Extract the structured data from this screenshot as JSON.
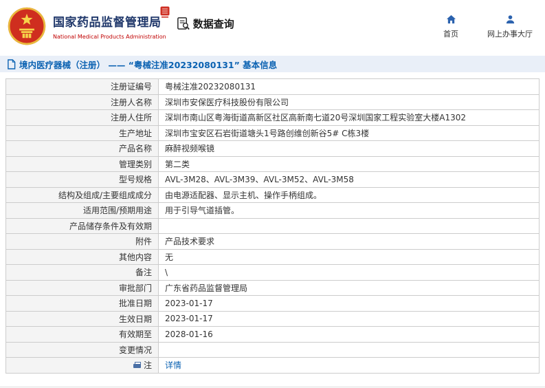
{
  "header": {
    "org_name": "国家药品监督管理局",
    "org_name_en": "National Medical Products Administration",
    "section_label": "数据查询",
    "nav": [
      {
        "label": "首页",
        "icon": "home-icon"
      },
      {
        "label": "网上办事大厅",
        "icon": "person-icon"
      }
    ]
  },
  "title_bar": {
    "text": "境内医疗器械（注册） —— “粤械注准20232080131” 基本信息"
  },
  "colors": {
    "accent_blue": "#0b62b2",
    "title_navy": "#20386b",
    "subtitle_red": "#c00000",
    "titlebar_bg": "#e9eff8",
    "label_bg": "#f4f4f4",
    "border": "#cccccc",
    "link": "#0b62b2"
  },
  "table": {
    "rows": [
      {
        "label": "注册证编号",
        "value": "粤械注准20232080131"
      },
      {
        "label": "注册人名称",
        "value": "深圳市安保医疗科技股份有限公司"
      },
      {
        "label": "注册人住所",
        "value": "深圳市南山区粤海街道高新区社区高新南七道20号深圳国家工程实验室大楼A1302"
      },
      {
        "label": "生产地址",
        "value": "深圳市宝安区石岩街道塘头1号路创维创新谷5# C栋3楼"
      },
      {
        "label": "产品名称",
        "value": "麻醉视频喉镜"
      },
      {
        "label": "管理类别",
        "value": "第二类"
      },
      {
        "label": "型号规格",
        "value": "AVL-3M28、AVL-3M39、AVL-3M52、AVL-3M58"
      },
      {
        "label": "结构及组成/主要组成成分",
        "value": "由电源适配器、显示主机、操作手柄组成。"
      },
      {
        "label": "适用范围/预期用途",
        "value": "用于引导气道插管。"
      },
      {
        "label": "产品储存条件及有效期",
        "value": ""
      },
      {
        "label": "附件",
        "value": "产品技术要求"
      },
      {
        "label": "其他内容",
        "value": "无"
      },
      {
        "label": "备注",
        "value": "\\"
      },
      {
        "label": "审批部门",
        "value": "广东省药品监督管理局"
      },
      {
        "label": "批准日期",
        "value": "2023-01-17"
      },
      {
        "label": "生效日期",
        "value": "2023-01-17"
      },
      {
        "label": "有效期至",
        "value": "2028-01-16"
      },
      {
        "label": "变更情况",
        "value": ""
      },
      {
        "label": "注",
        "value": "详情",
        "value_is_link": true,
        "label_icon": "print-icon"
      }
    ]
  }
}
